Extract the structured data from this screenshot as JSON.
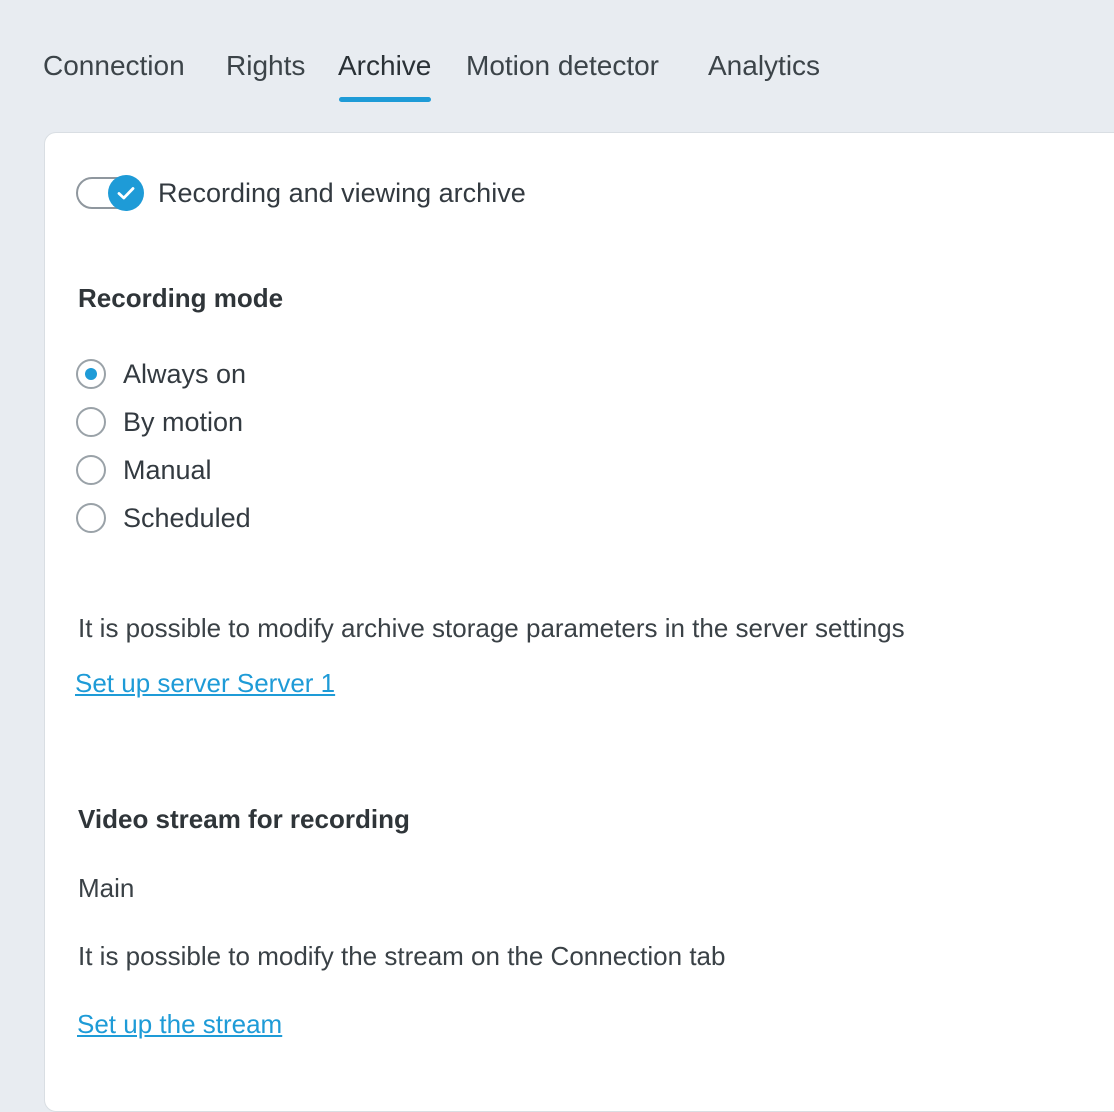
{
  "tabs": [
    {
      "label": "Connection"
    },
    {
      "label": "Rights"
    },
    {
      "label": "Archive"
    },
    {
      "label": "Motion detector"
    },
    {
      "label": "Analytics"
    }
  ],
  "active_tab": "Archive",
  "archive": {
    "toggle": {
      "label": "Recording and viewing archive",
      "enabled": true,
      "icon": "check-icon"
    },
    "recording_mode": {
      "heading": "Recording mode",
      "options": [
        {
          "label": "Always on",
          "selected": true
        },
        {
          "label": "By motion",
          "selected": false
        },
        {
          "label": "Manual",
          "selected": false
        },
        {
          "label": "Scheduled",
          "selected": false
        }
      ]
    },
    "storage_note": "It is possible to modify archive storage parameters in the server settings",
    "server_link": "Set up server Server 1",
    "video_stream": {
      "heading": "Video stream for recording",
      "value": "Main",
      "note": "It is possible to modify the stream on the Connection tab",
      "link": "Set up the stream"
    }
  },
  "colors": {
    "accent": "#1e9bd7",
    "background": "#e8ecf1",
    "panel": "#ffffff",
    "text": "#333a40"
  }
}
